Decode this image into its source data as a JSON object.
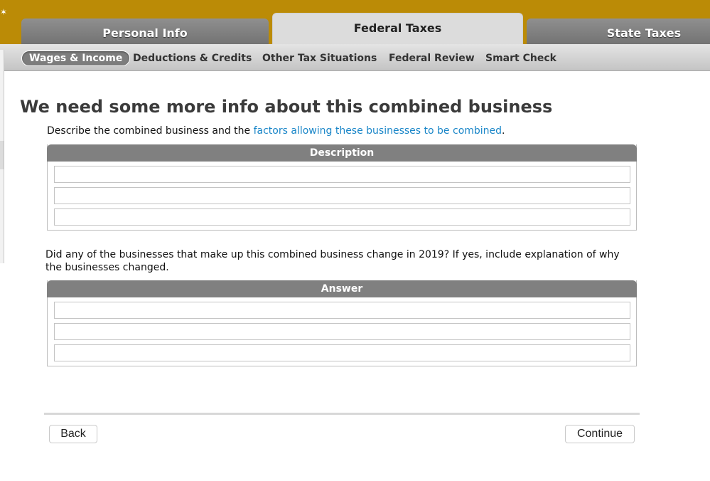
{
  "header": {
    "logo_fragment": "✶",
    "tabs": [
      {
        "label": "Personal Info",
        "active": false
      },
      {
        "label": "Federal Taxes",
        "active": true
      },
      {
        "label": "State Taxes",
        "active": false
      }
    ]
  },
  "subnav": {
    "items": [
      {
        "label": "Wages & Income",
        "active": true
      },
      {
        "label": "Deductions & Credits",
        "active": false
      },
      {
        "label": "Other Tax Situations",
        "active": false
      },
      {
        "label": "Federal Review",
        "active": false
      },
      {
        "label": "Smart Check",
        "active": false
      }
    ]
  },
  "main": {
    "title": "We need some more info about this combined business",
    "description_prompt": {
      "before": "Describe the combined business and the ",
      "link": "factors allowing these businesses to be combined",
      "after": "."
    },
    "description_group": {
      "header": "Description",
      "fields": [
        "",
        "",
        ""
      ]
    },
    "question": "Did any of the businesses that make up this combined business change in 2019? If yes, include explanation of why the businesses changed.",
    "answer_group": {
      "header": "Answer",
      "fields": [
        "",
        "",
        ""
      ]
    }
  },
  "footer": {
    "back_label": "Back",
    "continue_label": "Continue"
  },
  "colors": {
    "banner": "#bb8b06",
    "link": "#1a86c8",
    "group_header": "#808080"
  }
}
